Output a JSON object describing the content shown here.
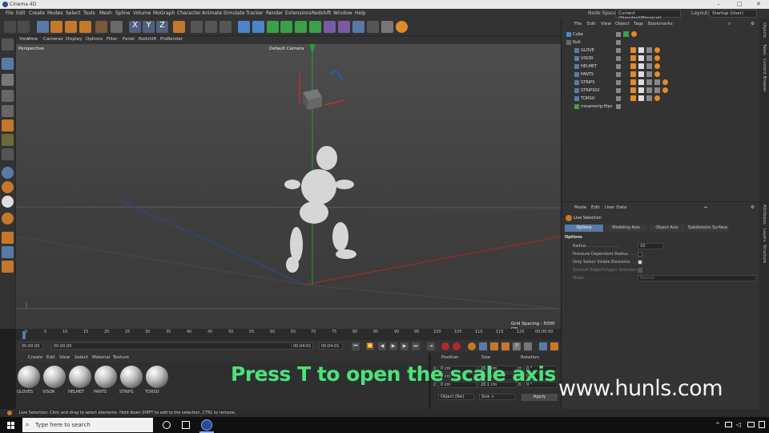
{
  "window": {
    "title": "Cinema 4D"
  },
  "menubar": {
    "items": [
      "File",
      "Edit",
      "Create",
      "Modes",
      "Select",
      "Tools",
      "Mesh",
      "Spline",
      "Volume",
      "MoGraph",
      "Character",
      "Animate",
      "Simulate",
      "Tracker",
      "Render",
      "Extensions",
      "Redshift",
      "Window",
      "Help"
    ],
    "node_space_label": "Node Space:",
    "node_space_value": "Current (Standard/Physical)",
    "layout_label": "Layout:",
    "layout_value": "Startup (User)"
  },
  "viewport_menu": {
    "items": [
      "View",
      "Cameras",
      "Display",
      "Options",
      "Filter",
      "Panel",
      "Redshift",
      "ProRender"
    ]
  },
  "viewport": {
    "name": "Perspective",
    "camera": "Default Camera",
    "grid_spacing": "Grid Spacing : 5000 cm"
  },
  "timeline": {
    "ticks": [
      "0",
      "5",
      "10",
      "15",
      "20",
      "25",
      "30",
      "35",
      "40",
      "45",
      "50",
      "55",
      "60",
      "65",
      "70",
      "75",
      "80",
      "85",
      "90",
      "95",
      "100",
      "105",
      "110",
      "115",
      "120"
    ],
    "end_frame": "00:00:00",
    "current": "00:00:00",
    "start": "00:00:00",
    "range_end": "00:04:01",
    "max": "00:04:01"
  },
  "materials": {
    "menu": [
      "Create",
      "Edit",
      "View",
      "Select",
      "Material",
      "Texture"
    ],
    "items": [
      "GLOVES",
      "VISOR",
      "HELMET",
      "PANTS",
      "STRIPS",
      "TORSO"
    ]
  },
  "coordinates": {
    "headers": [
      "Position",
      "Size",
      "Rotation"
    ],
    "rows": [
      {
        "axis": "X",
        "pos": "0 cm",
        "size": "20.1 cm",
        "rot_axis": "H",
        "rot": "0 °"
      },
      {
        "axis": "Y",
        "pos": "0 cm",
        "size": "20.1 cm",
        "rot_axis": "P",
        "rot": "0 °"
      },
      {
        "axis": "Z",
        "pos": "0 cm",
        "size": "20.1 cm",
        "rot_axis": "B",
        "rot": "0 °"
      }
    ],
    "mode": "Object (Rel)",
    "size_mode": "Size +",
    "apply": "Apply"
  },
  "object_manager": {
    "menu": [
      "File",
      "Edit",
      "View",
      "Object",
      "Tags",
      "Bookmarks"
    ],
    "objects": [
      "Cube",
      "Null",
      "GLOVE",
      "VISOR",
      "HELMET",
      "PANTS",
      "STRIPS",
      "STRIPS02",
      "TORSO",
      "mixamorig:Hips"
    ]
  },
  "attribute_manager": {
    "menu": [
      "Mode",
      "Edit",
      "User Data"
    ],
    "tool_name": "Live Selection",
    "tabs": [
      "Options",
      "Modeling Axis",
      "Object Axis",
      "Subdivision Surface"
    ],
    "section": "Options",
    "radius_label": "Radius . . . . . . . . . . . . .",
    "radius_value": "10",
    "options": [
      "Pressure Dependent Radius . . .",
      "Only Select Visible Elements. . .",
      "Tolerant Edge/Polygon Selection",
      "Mode . . . . . . . . . . . . . . ."
    ],
    "mode_value": "Normal"
  },
  "right_tabs": [
    "Objects",
    "Takes",
    "Content Browser",
    "Layers",
    "Attributes",
    "Structure"
  ],
  "status": {
    "text": "Live Selection: Click and drag to select elements. Hold down SHIFT to add to the selection, CTRL to remove."
  },
  "taskbar": {
    "search_placeholder": "Type here to search"
  },
  "overlay": {
    "caption": "Press T to open the scale axis",
    "watermark": "www.hunls.com"
  },
  "colors": {
    "caption_green": "#4be27c",
    "accent_blue": "#5a7aa6",
    "orange": "#e08a2c"
  }
}
